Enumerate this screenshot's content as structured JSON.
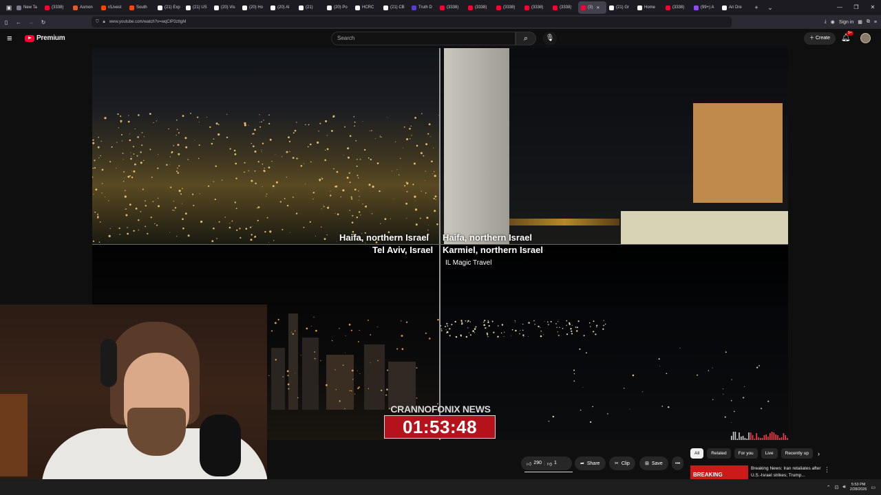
{
  "browser": {
    "tabs": [
      {
        "label": "New Ta",
        "color": "#7a7a8a",
        "active": false
      },
      {
        "label": "(3338)",
        "color": "#ff0033",
        "active": false
      },
      {
        "label": "Asmon",
        "color": "#e05a2a",
        "active": false
      },
      {
        "label": "r/Livest",
        "color": "#ff4500",
        "active": false
      },
      {
        "label": "South",
        "color": "#ff4500",
        "active": false
      },
      {
        "label": "(21) Exp",
        "color": "#ffffff",
        "active": false
      },
      {
        "label": "(21) US",
        "color": "#ffffff",
        "active": false
      },
      {
        "label": "(20) Vis",
        "color": "#ffffff",
        "active": false
      },
      {
        "label": "(20) Ho",
        "color": "#ffffff",
        "active": false
      },
      {
        "label": "(20) Al",
        "color": "#ffffff",
        "active": false
      },
      {
        "label": "(21)",
        "color": "#ffffff",
        "active": false
      },
      {
        "label": "(20) Po",
        "color": "#ffffff",
        "active": false
      },
      {
        "label": "HCRC",
        "color": "#ffffff",
        "active": false
      },
      {
        "label": "(21) CB",
        "color": "#ffffff",
        "active": false
      },
      {
        "label": "Truth D",
        "color": "#5a3ad8",
        "active": false
      },
      {
        "label": "(3338)",
        "color": "#ff0033",
        "active": false
      },
      {
        "label": "(3338)",
        "color": "#ff0033",
        "active": false
      },
      {
        "label": "(3338)",
        "color": "#ff0033",
        "active": false
      },
      {
        "label": "(3338)",
        "color": "#ff0033",
        "active": false
      },
      {
        "label": "(3338)",
        "color": "#ff0033",
        "active": false
      },
      {
        "label": "(3)",
        "color": "#ff0033",
        "active": true
      },
      {
        "label": "(21) Gr",
        "color": "#ffffff",
        "active": false
      },
      {
        "label": "Home",
        "color": "#ffffff",
        "active": false
      },
      {
        "label": "(3338)",
        "color": "#ff0033",
        "active": false
      },
      {
        "label": "(99+) A",
        "color": "#9146ff",
        "active": false
      },
      {
        "label": "Ari Dre",
        "color": "#ffffff",
        "active": false
      }
    ],
    "new_tab_icon": "+",
    "tab_list_icon": "⌄",
    "url": "www.youtube.com/watch?v=wqCIP3ztIgM",
    "sign_in": "Sign in"
  },
  "youtube": {
    "logo_text": "Premium",
    "search_placeholder": "Search",
    "create_label": "Create",
    "notification_count": "9+"
  },
  "video": {
    "captions": {
      "q1_line1": "Haifa, northern Israel",
      "q1_line2": "Tel Aviv, Israel",
      "q2_line1": "Haifa, northern Israel",
      "q2_line2": "Karmiel, northern Israel"
    },
    "credit": "IL Magic Travel",
    "brand": "CRANNOFONIX NEWS",
    "timer": "01:53:48"
  },
  "actions": {
    "likes": "290",
    "dislikes": "1",
    "share": "Share",
    "clip": "Clip",
    "save": "Save",
    "more": "•••"
  },
  "chips": [
    "All",
    "Related",
    "For you",
    "Live",
    "Recently up"
  ],
  "recommendation": {
    "thumb_text": "BREAKING",
    "title": "Breaking News: Iran retaliates after U.S.-Israel strikes; Trump..."
  },
  "taskbar": {
    "time": "5:53 PM",
    "date": "2/28/2026"
  }
}
